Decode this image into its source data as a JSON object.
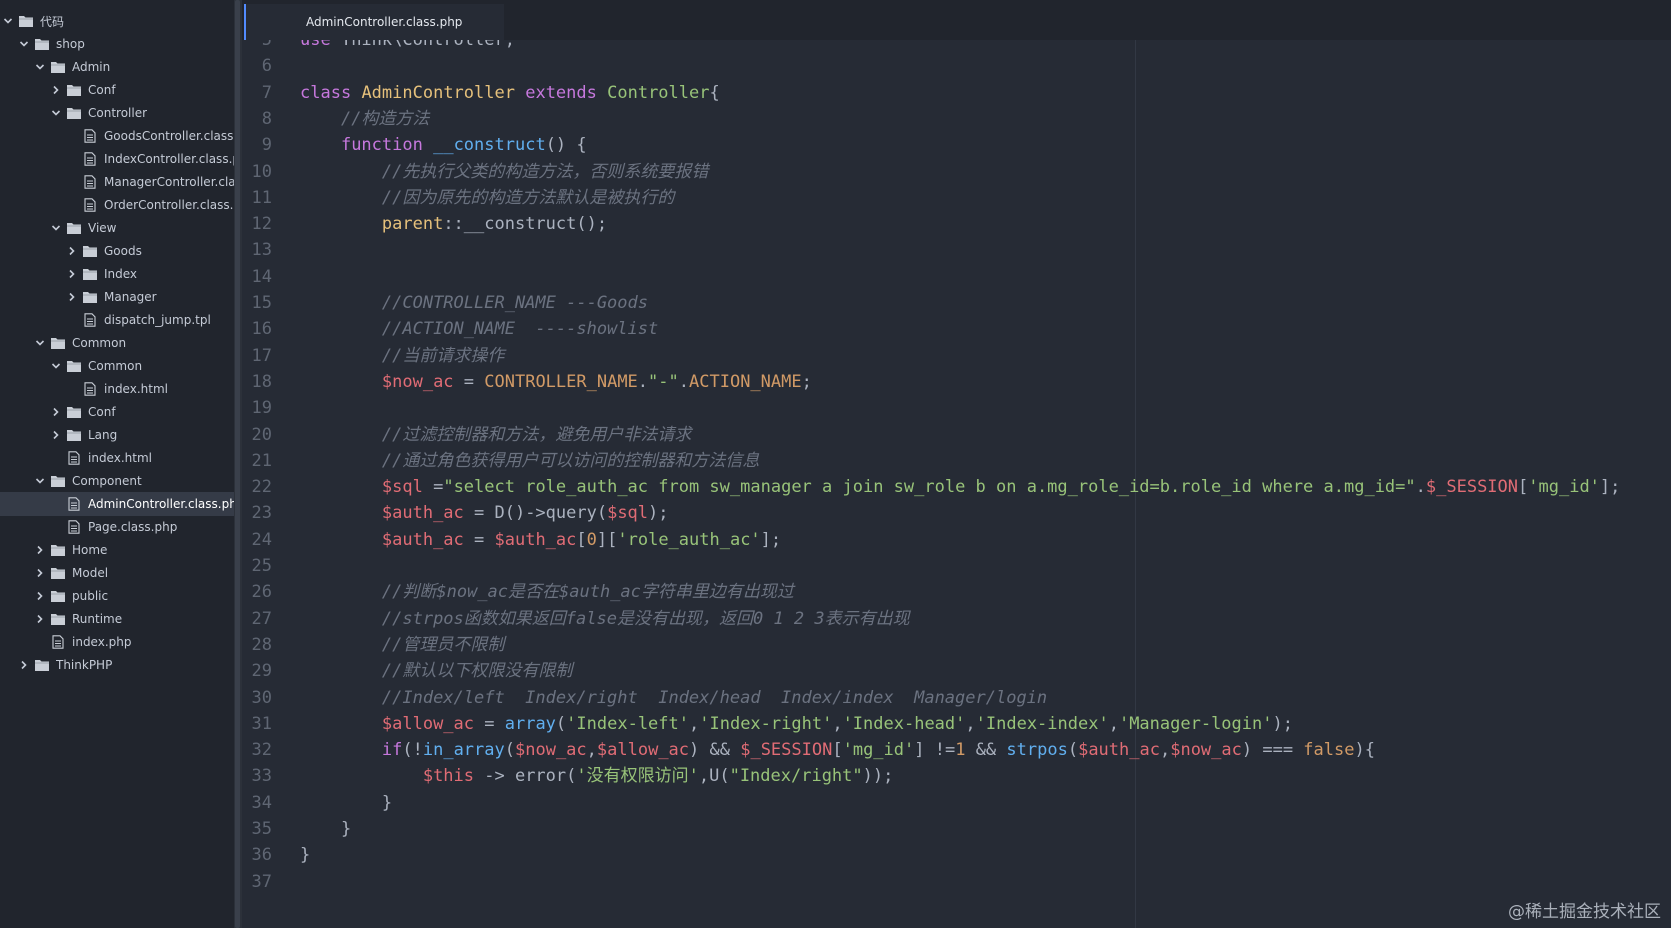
{
  "tree": [
    {
      "label": "代码",
      "level": 0,
      "type": "folder",
      "open": true
    },
    {
      "label": "shop",
      "level": 1,
      "type": "folder",
      "open": true
    },
    {
      "label": "Admin",
      "level": 2,
      "type": "folder",
      "open": true
    },
    {
      "label": "Conf",
      "level": 3,
      "type": "folder",
      "open": false
    },
    {
      "label": "Controller",
      "level": 3,
      "type": "folder",
      "open": true
    },
    {
      "label": "GoodsController.class.p",
      "level": 4,
      "type": "file"
    },
    {
      "label": "IndexController.class.ph",
      "level": 4,
      "type": "file"
    },
    {
      "label": "ManagerController.class",
      "level": 4,
      "type": "file"
    },
    {
      "label": "OrderController.class.ph",
      "level": 4,
      "type": "file"
    },
    {
      "label": "View",
      "level": 3,
      "type": "folder",
      "open": true
    },
    {
      "label": "Goods",
      "level": 4,
      "type": "folder",
      "open": false
    },
    {
      "label": "Index",
      "level": 4,
      "type": "folder",
      "open": false
    },
    {
      "label": "Manager",
      "level": 4,
      "type": "folder",
      "open": false
    },
    {
      "label": "dispatch_jump.tpl",
      "level": 4,
      "type": "file"
    },
    {
      "label": "Common",
      "level": 2,
      "type": "folder",
      "open": true
    },
    {
      "label": "Common",
      "level": 3,
      "type": "folder",
      "open": true
    },
    {
      "label": "index.html",
      "level": 4,
      "type": "file"
    },
    {
      "label": "Conf",
      "level": 3,
      "type": "folder",
      "open": false
    },
    {
      "label": "Lang",
      "level": 3,
      "type": "folder",
      "open": false
    },
    {
      "label": "index.html",
      "level": 3,
      "type": "file"
    },
    {
      "label": "Component",
      "level": 2,
      "type": "folder",
      "open": true
    },
    {
      "label": "AdminController.class.php",
      "level": 3,
      "type": "file",
      "selected": true
    },
    {
      "label": "Page.class.php",
      "level": 3,
      "type": "file"
    },
    {
      "label": "Home",
      "level": 2,
      "type": "folder",
      "open": false
    },
    {
      "label": "Model",
      "level": 2,
      "type": "folder",
      "open": false
    },
    {
      "label": "public",
      "level": 2,
      "type": "folder",
      "open": false
    },
    {
      "label": "Runtime",
      "level": 2,
      "type": "folder",
      "open": false
    },
    {
      "label": "index.php",
      "level": 2,
      "type": "file"
    },
    {
      "label": "ThinkPHP",
      "level": 1,
      "type": "folder",
      "open": false
    }
  ],
  "tab": {
    "title": "AdminController.class.php"
  },
  "code_lines": [
    {
      "n": "5",
      "tokens": [
        [
          "kw",
          "use"
        ],
        [
          "pl",
          " Think\\Controller;"
        ]
      ]
    },
    {
      "n": "6",
      "tokens": []
    },
    {
      "n": "7",
      "tokens": [
        [
          "kw",
          "class"
        ],
        [
          "pl",
          " "
        ],
        [
          "cls",
          "AdminController"
        ],
        [
          "pl",
          " "
        ],
        [
          "kw",
          "extends"
        ],
        [
          "pl",
          " "
        ],
        [
          "inh",
          "Controller"
        ],
        [
          "pl",
          "{"
        ]
      ]
    },
    {
      "n": "8",
      "tokens": [
        [
          "pl",
          "    "
        ],
        [
          "cm",
          "//构造方法"
        ]
      ]
    },
    {
      "n": "9",
      "tokens": [
        [
          "pl",
          "    "
        ],
        [
          "kw",
          "function"
        ],
        [
          "pl",
          " "
        ],
        [
          "fn",
          "__construct"
        ],
        [
          "pl",
          "() {"
        ]
      ]
    },
    {
      "n": "10",
      "tokens": [
        [
          "pl",
          "        "
        ],
        [
          "cm",
          "//先执行父类的构造方法，否则系统要报错"
        ]
      ]
    },
    {
      "n": "11",
      "tokens": [
        [
          "pl",
          "        "
        ],
        [
          "cm",
          "//因为原先的构造方法默认是被执行的"
        ]
      ]
    },
    {
      "n": "12",
      "tokens": [
        [
          "pl",
          "        "
        ],
        [
          "par",
          "parent"
        ],
        [
          "pl",
          "::__construct();"
        ]
      ]
    },
    {
      "n": "13",
      "tokens": []
    },
    {
      "n": "14",
      "tokens": []
    },
    {
      "n": "15",
      "tokens": [
        [
          "pl",
          "        "
        ],
        [
          "cm",
          "//CONTROLLER_NAME ---Goods"
        ]
      ]
    },
    {
      "n": "16",
      "tokens": [
        [
          "pl",
          "        "
        ],
        [
          "cm",
          "//ACTION_NAME  ----showlist"
        ]
      ]
    },
    {
      "n": "17",
      "tokens": [
        [
          "pl",
          "        "
        ],
        [
          "cm",
          "//当前请求操作"
        ]
      ]
    },
    {
      "n": "18",
      "tokens": [
        [
          "pl",
          "        "
        ],
        [
          "var",
          "$now_ac"
        ],
        [
          "pl",
          " = "
        ],
        [
          "cst",
          "CONTROLLER_NAME"
        ],
        [
          "pl",
          "."
        ],
        [
          "str",
          "\"-\""
        ],
        [
          "pl",
          "."
        ],
        [
          "cst",
          "ACTION_NAME"
        ],
        [
          "pl",
          ";"
        ]
      ]
    },
    {
      "n": "19",
      "tokens": []
    },
    {
      "n": "20",
      "tokens": [
        [
          "pl",
          "        "
        ],
        [
          "cm",
          "//过滤控制器和方法，避免用户非法请求"
        ]
      ]
    },
    {
      "n": "21",
      "tokens": [
        [
          "pl",
          "        "
        ],
        [
          "cm",
          "//通过角色获得用户可以访问的控制器和方法信息"
        ]
      ]
    },
    {
      "n": "22",
      "tokens": [
        [
          "pl",
          "        "
        ],
        [
          "var",
          "$sql"
        ],
        [
          "pl",
          " ="
        ],
        [
          "str",
          "\"select role_auth_ac from sw_manager a join sw_role b on a.mg_role_id=b.role_id where a.mg_id=\""
        ],
        [
          "pl",
          "."
        ],
        [
          "var",
          "$_SESSION"
        ],
        [
          "pl",
          "["
        ],
        [
          "str",
          "'mg_id'"
        ],
        [
          "pl",
          "];"
        ]
      ]
    },
    {
      "n": "23",
      "tokens": [
        [
          "pl",
          "        "
        ],
        [
          "var",
          "$auth_ac"
        ],
        [
          "pl",
          " = D()->query("
        ],
        [
          "var",
          "$sql"
        ],
        [
          "pl",
          ");"
        ]
      ]
    },
    {
      "n": "24",
      "tokens": [
        [
          "pl",
          "        "
        ],
        [
          "var",
          "$auth_ac"
        ],
        [
          "pl",
          " = "
        ],
        [
          "var",
          "$auth_ac"
        ],
        [
          "pl",
          "["
        ],
        [
          "num",
          "0"
        ],
        [
          "pl",
          "]["
        ],
        [
          "str",
          "'role_auth_ac'"
        ],
        [
          "pl",
          "];"
        ]
      ]
    },
    {
      "n": "25",
      "tokens": []
    },
    {
      "n": "26",
      "tokens": [
        [
          "pl",
          "        "
        ],
        [
          "cm",
          "//判断$now_ac是否在$auth_ac字符串里边有出现过"
        ]
      ]
    },
    {
      "n": "27",
      "tokens": [
        [
          "pl",
          "        "
        ],
        [
          "cm",
          "//strpos函数如果返回false是没有出现，返回0 1 2 3表示有出现"
        ]
      ]
    },
    {
      "n": "28",
      "tokens": [
        [
          "pl",
          "        "
        ],
        [
          "cm",
          "//管理员不限制"
        ]
      ]
    },
    {
      "n": "29",
      "tokens": [
        [
          "pl",
          "        "
        ],
        [
          "cm",
          "//默认以下权限没有限制"
        ]
      ]
    },
    {
      "n": "30",
      "tokens": [
        [
          "pl",
          "        "
        ],
        [
          "cm",
          "//Index/left  Index/right  Index/head  Index/index  Manager/login"
        ]
      ]
    },
    {
      "n": "31",
      "tokens": [
        [
          "pl",
          "        "
        ],
        [
          "var",
          "$allow_ac"
        ],
        [
          "pl",
          " = "
        ],
        [
          "fn",
          "array"
        ],
        [
          "pl",
          "("
        ],
        [
          "str",
          "'Index-left'"
        ],
        [
          "pl",
          ","
        ],
        [
          "str",
          "'Index-right'"
        ],
        [
          "pl",
          ","
        ],
        [
          "str",
          "'Index-head'"
        ],
        [
          "pl",
          ","
        ],
        [
          "str",
          "'Index-index'"
        ],
        [
          "pl",
          ","
        ],
        [
          "str",
          "'Manager-login'"
        ],
        [
          "pl",
          ");"
        ]
      ]
    },
    {
      "n": "32",
      "tokens": [
        [
          "pl",
          "        "
        ],
        [
          "kw",
          "if"
        ],
        [
          "pl",
          "(!"
        ],
        [
          "fn",
          "in_array"
        ],
        [
          "pl",
          "("
        ],
        [
          "var",
          "$now_ac"
        ],
        [
          "pl",
          ","
        ],
        [
          "var",
          "$allow_ac"
        ],
        [
          "pl",
          ") && "
        ],
        [
          "var",
          "$_SESSION"
        ],
        [
          "pl",
          "["
        ],
        [
          "str",
          "'mg_id'"
        ],
        [
          "pl",
          "] !="
        ],
        [
          "num",
          "1"
        ],
        [
          "pl",
          " && "
        ],
        [
          "fn",
          "strpos"
        ],
        [
          "pl",
          "("
        ],
        [
          "var",
          "$auth_ac"
        ],
        [
          "pl",
          ","
        ],
        [
          "var",
          "$now_ac"
        ],
        [
          "pl",
          ") === "
        ],
        [
          "cst",
          "false"
        ],
        [
          "pl",
          "){"
        ]
      ]
    },
    {
      "n": "33",
      "tokens": [
        [
          "pl",
          "            "
        ],
        [
          "var",
          "$this"
        ],
        [
          "pl",
          " -> error("
        ],
        [
          "str",
          "'没有权限访问'"
        ],
        [
          "pl",
          ",U("
        ],
        [
          "str",
          "\"Index/right\""
        ],
        [
          "pl",
          "));"
        ]
      ]
    },
    {
      "n": "34",
      "tokens": [
        [
          "pl",
          "        }"
        ]
      ]
    },
    {
      "n": "35",
      "tokens": [
        [
          "pl",
          "    }"
        ]
      ]
    },
    {
      "n": "36",
      "tokens": [
        [
          "pl",
          "}"
        ]
      ]
    },
    {
      "n": "37",
      "tokens": []
    }
  ],
  "watermark": "@稀土掘金技术社区"
}
